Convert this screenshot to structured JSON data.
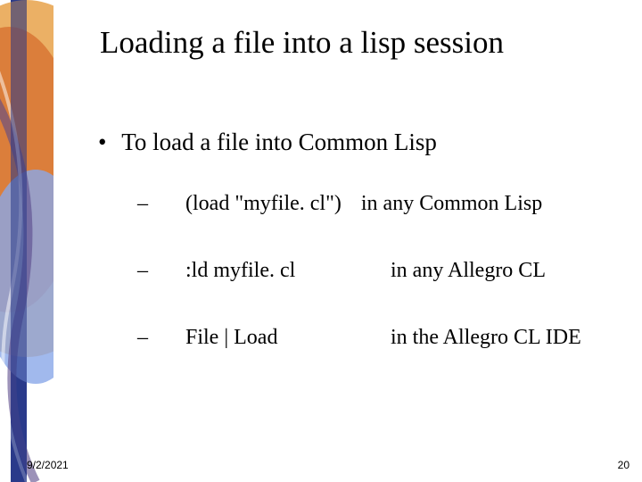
{
  "slide": {
    "title": "Loading a file into a lisp session",
    "main_bullet": "To load a file into Common Lisp",
    "items": [
      {
        "cmd": "(load \"myfile. cl\")",
        "where": "in any Common Lisp"
      },
      {
        "cmd": ":ld myfile. cl",
        "where": "in any Allegro CL"
      },
      {
        "cmd": "File | Load",
        "where": "in the Allegro CL IDE"
      }
    ]
  },
  "footer": {
    "date": "9/2/2021",
    "page": "20"
  },
  "glyphs": {
    "bullet": "•",
    "dash": "–"
  }
}
